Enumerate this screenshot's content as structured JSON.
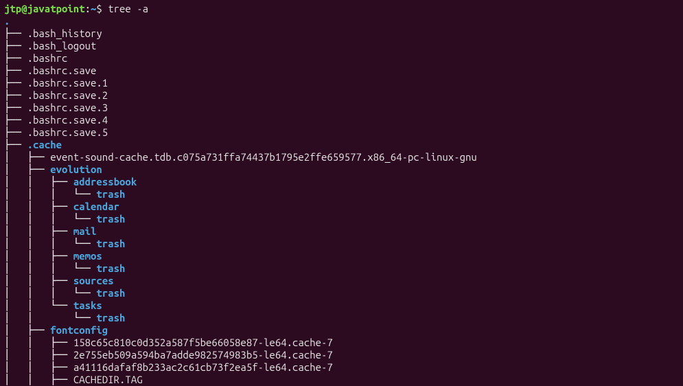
{
  "prompt": {
    "user": "jtp@javatpoint",
    "sep": ":",
    "path": "~",
    "dollar": "$ ",
    "command": "tree -a"
  },
  "root": {
    "name": ".",
    "type": "dir"
  },
  "tree": [
    {
      "prefix": "├── ",
      "name": ".bash_history",
      "type": "file"
    },
    {
      "prefix": "├── ",
      "name": ".bash_logout",
      "type": "file"
    },
    {
      "prefix": "├── ",
      "name": ".bashrc",
      "type": "file"
    },
    {
      "prefix": "├── ",
      "name": ".bashrc.save",
      "type": "file"
    },
    {
      "prefix": "├── ",
      "name": ".bashrc.save.1",
      "type": "file"
    },
    {
      "prefix": "├── ",
      "name": ".bashrc.save.2",
      "type": "file"
    },
    {
      "prefix": "├── ",
      "name": ".bashrc.save.3",
      "type": "file"
    },
    {
      "prefix": "├── ",
      "name": ".bashrc.save.4",
      "type": "file"
    },
    {
      "prefix": "├── ",
      "name": ".bashrc.save.5",
      "type": "file"
    },
    {
      "prefix": "├── ",
      "name": ".cache",
      "type": "dir"
    },
    {
      "prefix": "│   ├── ",
      "name": "event-sound-cache.tdb.c075a731ffa74437b1795e2ffe659577.x86_64-pc-linux-gnu",
      "type": "file"
    },
    {
      "prefix": "│   ├── ",
      "name": "evolution",
      "type": "dir"
    },
    {
      "prefix": "│   │   ├── ",
      "name": "addressbook",
      "type": "dir"
    },
    {
      "prefix": "│   │   │   └── ",
      "name": "trash",
      "type": "dir"
    },
    {
      "prefix": "│   │   ├── ",
      "name": "calendar",
      "type": "dir"
    },
    {
      "prefix": "│   │   │   └── ",
      "name": "trash",
      "type": "dir"
    },
    {
      "prefix": "│   │   ├── ",
      "name": "mail",
      "type": "dir"
    },
    {
      "prefix": "│   │   │   └── ",
      "name": "trash",
      "type": "dir"
    },
    {
      "prefix": "│   │   ├── ",
      "name": "memos",
      "type": "dir"
    },
    {
      "prefix": "│   │   │   └── ",
      "name": "trash",
      "type": "dir"
    },
    {
      "prefix": "│   │   ├── ",
      "name": "sources",
      "type": "dir"
    },
    {
      "prefix": "│   │   │   └── ",
      "name": "trash",
      "type": "dir"
    },
    {
      "prefix": "│   │   └── ",
      "name": "tasks",
      "type": "dir"
    },
    {
      "prefix": "│   │       └── ",
      "name": "trash",
      "type": "dir"
    },
    {
      "prefix": "│   ├── ",
      "name": "fontconfig",
      "type": "dir"
    },
    {
      "prefix": "│   │   ├── ",
      "name": "158c65c810c0d352a587f5be66058e87-le64.cache-7",
      "type": "file"
    },
    {
      "prefix": "│   │   ├── ",
      "name": "2e755eb509a594ba7adde982574983b5-le64.cache-7",
      "type": "file"
    },
    {
      "prefix": "│   │   ├── ",
      "name": "a41116dafaf8b233ac2c61cb73f2ea5f-le64.cache-7",
      "type": "file"
    },
    {
      "prefix": "│   │   ├── ",
      "name": "CACHEDIR.TAG",
      "type": "file"
    }
  ]
}
